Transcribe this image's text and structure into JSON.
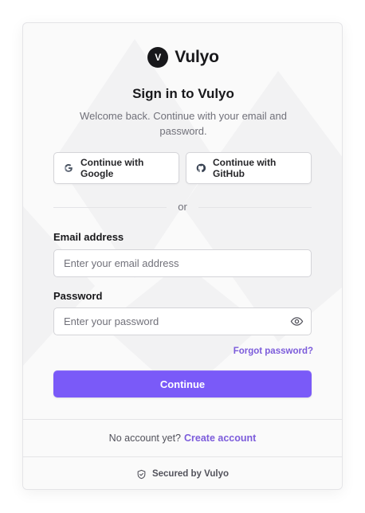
{
  "brand": {
    "logo_letter": "V",
    "name": "Vulyo"
  },
  "heading": {
    "title": "Sign in to Vulyo",
    "subtitle": "Welcome back. Continue with your email and password."
  },
  "social": {
    "google": {
      "label": "Continue with Google",
      "icon": "google-icon"
    },
    "github": {
      "label": "Continue with GitHub",
      "icon": "github-icon"
    }
  },
  "divider": {
    "text": "or"
  },
  "form": {
    "email": {
      "label": "Email address",
      "placeholder": "Enter your email address",
      "value": ""
    },
    "password": {
      "label": "Password",
      "placeholder": "Enter your password",
      "value": "",
      "toggle_icon": "eye-icon"
    },
    "forgot_label": "Forgot password?",
    "submit_label": "Continue"
  },
  "footer": {
    "signup_prompt": "No account yet?",
    "signup_link": "Create account",
    "secured_text": "Secured by Vulyo",
    "secured_icon": "shield-check-icon"
  },
  "colors": {
    "accent": "#7a5af8",
    "link": "#7c5cdb",
    "text": "#18181b",
    "muted": "#71717a",
    "border": "#d4d4d8"
  }
}
